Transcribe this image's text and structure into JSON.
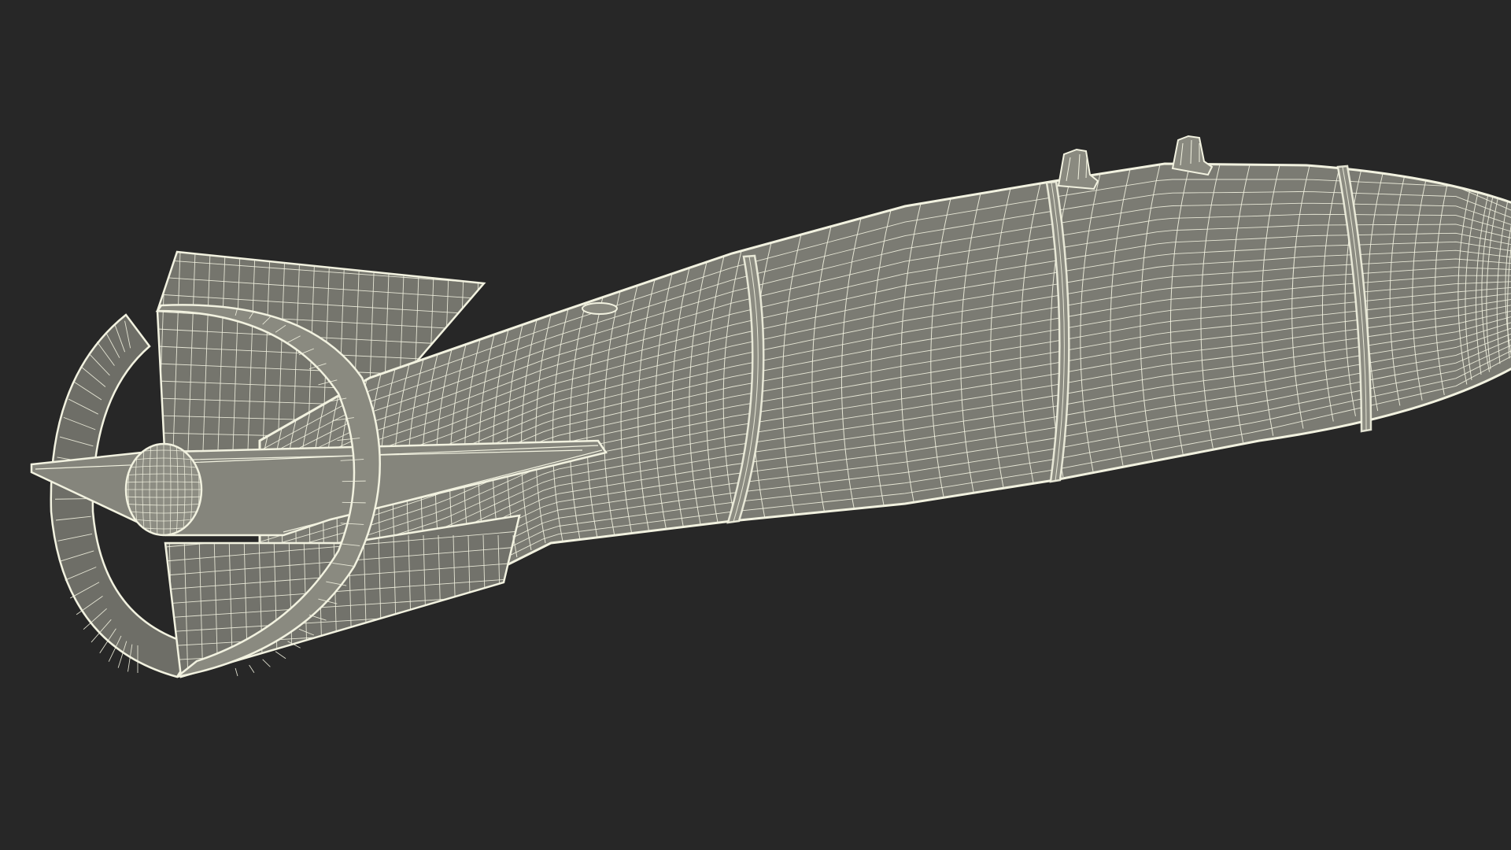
{
  "scene": {
    "background_color": "#272727",
    "model_fill_color": "#7a7a72",
    "model_shadow_color": "#5e5e57",
    "wire_color": "#f2f2e0",
    "model": "aerial-bomb-wireframe",
    "components": [
      "nose-cone",
      "main-body",
      "band-rings",
      "suspension-lugs",
      "tail-cone",
      "tail-fins",
      "ring-tail",
      "tail-cap"
    ]
  }
}
